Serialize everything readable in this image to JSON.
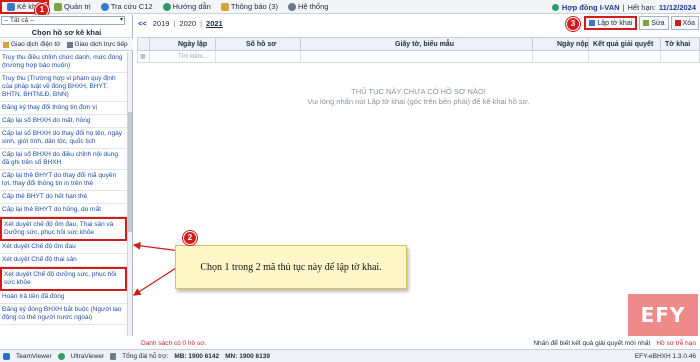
{
  "menu": {
    "items": [
      {
        "label": "Kê khai",
        "icon": "declare-icon",
        "color": "#3b78c7"
      },
      {
        "label": "Quản trị",
        "icon": "admin-icon",
        "color": "#7aa344"
      },
      {
        "label": "Tra cứu C12",
        "icon": "lookup-icon",
        "color": "#3b78c7"
      },
      {
        "label": "Hướng dẫn",
        "icon": "help-icon",
        "color": "#2f9d6a"
      },
      {
        "label": "Thông báo (3)",
        "icon": "bell-icon",
        "color": "#d6a23a"
      },
      {
        "label": "Hệ thống",
        "icon": "gear-icon",
        "color": "#6d7a89"
      }
    ],
    "contract_label": "Hợp đồng I-VAN",
    "expiry_label": "Hết hạn:",
    "expiry_date": "11/12/2024"
  },
  "left": {
    "filter_value": "-- Tất cả --",
    "title": "Chọn hồ sơ kê khai",
    "tabs": [
      "Giao dịch điện tử",
      "Giao dịch trực tiếp"
    ],
    "procedures": [
      "Truy thu điều chỉnh chức danh, mức đóng (trường hợp bảo muộn)",
      "Truy thu (Trường hợp vi phạm quy định của pháp luật về đóng BHXH, BHYT, BHTN, BHTNLĐ, BNN)",
      "Đăng ký thay đổi thông tin đơn vị",
      "Cấp lại sổ BHXH do mất, hỏng",
      "Cấp lại sổ BHXH do thay đổi họ tên, ngày sinh, giới tính, dân tộc, quốc tịch",
      "Cấp lại sổ BHXH do điều chỉnh nội dung đã ghi trên sổ BHXH",
      "Cấp lại thẻ BHYT do thay đổi mã quyền lợi, thay đổi thông tin in trên thẻ",
      "Cấp thẻ BHYT do hết hạn thẻ",
      "Cấp lại thẻ BHYT do hỏng, do mất",
      "Xét duyệt chế độ ốm đau, Thai sản và Dưỡng sức, phục hồi sức khỏe",
      "Xét duyệt Chế độ ốm đau",
      "Xét duyệt Chế độ thai sản",
      "Xét duyệt Chế độ dưỡng sức, phục hồi sức khỏe",
      "Hoàn trả tiền đã đóng",
      "Đăng ký đóng BHXH bắt buộc (Người lao động có thẻ người nước ngoài)"
    ]
  },
  "years": {
    "prev": "<<",
    "items": [
      "2019",
      "2020",
      "2021"
    ],
    "selected": "2021"
  },
  "toolbar": {
    "create_label": "Lập tờ khai",
    "edit_label": "Sửa",
    "delete_label": "Xóa"
  },
  "grid": {
    "columns": [
      "Ngày lập",
      "Số hồ sơ",
      "Giấy tờ, biểu mẫu",
      "Ngày nộp",
      "Kết quả giải quyết",
      "Tờ khai"
    ],
    "search_placeholder": "Tìm kiếm...",
    "empty_title": "THỦ TỤC NÀY CHƯA CÓ HỒ SƠ NÀO!",
    "empty_hint": "Vui lòng nhấn nút Lập tờ khai (góc trên bên phải) để kê khai hồ sơ."
  },
  "callout": {
    "text": "Chọn 1 trong 2 mã thủ tục này để lập tờ khai."
  },
  "badges": [
    "1",
    "2",
    "3"
  ],
  "logo_text": "EFY",
  "status": {
    "left": "Danh sách có 0 hồ sơ.",
    "middle": "Nhấn để biết kết quả giải quyết mới nhất",
    "overdue": "Hồ sơ trễ hạn"
  },
  "taskbar": {
    "teamviewer": "TeamViewer",
    "ultraviewer": "UltraViewer",
    "hotline_label": "Tổng đài hỗ trợ:",
    "hotline_mb": "MB: 1900 6142",
    "hotline_mn": "MN: 1900 6139",
    "version": "EFY-eBHXH 1.3.0.46"
  },
  "colors": {
    "accent": "#d11c1c",
    "link": "#1f4fa8",
    "callout_bg": "#fff7c7"
  }
}
